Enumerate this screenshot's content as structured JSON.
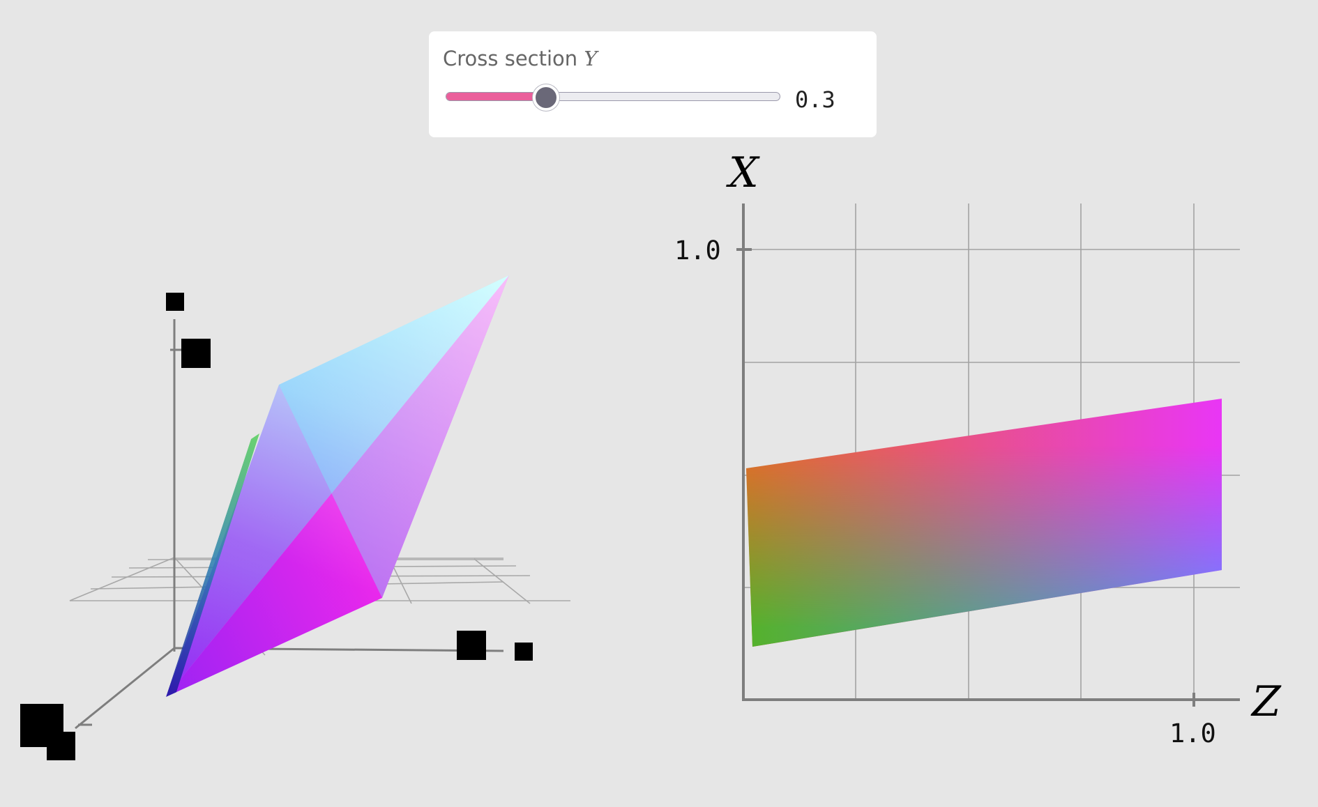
{
  "slider": {
    "label": "Cross section",
    "variable": "Y",
    "value_text": "0.3",
    "value": 0.3,
    "min": 0,
    "max": 1,
    "fill_color": "#ea5f9b",
    "thumb_color": "#6a6878"
  },
  "plot3d": {
    "description_icons": [
      "axis-end-marker",
      "axis-label-box"
    ]
  },
  "plot2d": {
    "y_axis_label": "X",
    "x_axis_label": "Z",
    "y_tick_label": "1.0",
    "x_tick_label": "1.0",
    "x_range": [
      0,
      1.1
    ],
    "y_range": [
      0,
      1.1
    ],
    "grid_step": 0.25
  }
}
